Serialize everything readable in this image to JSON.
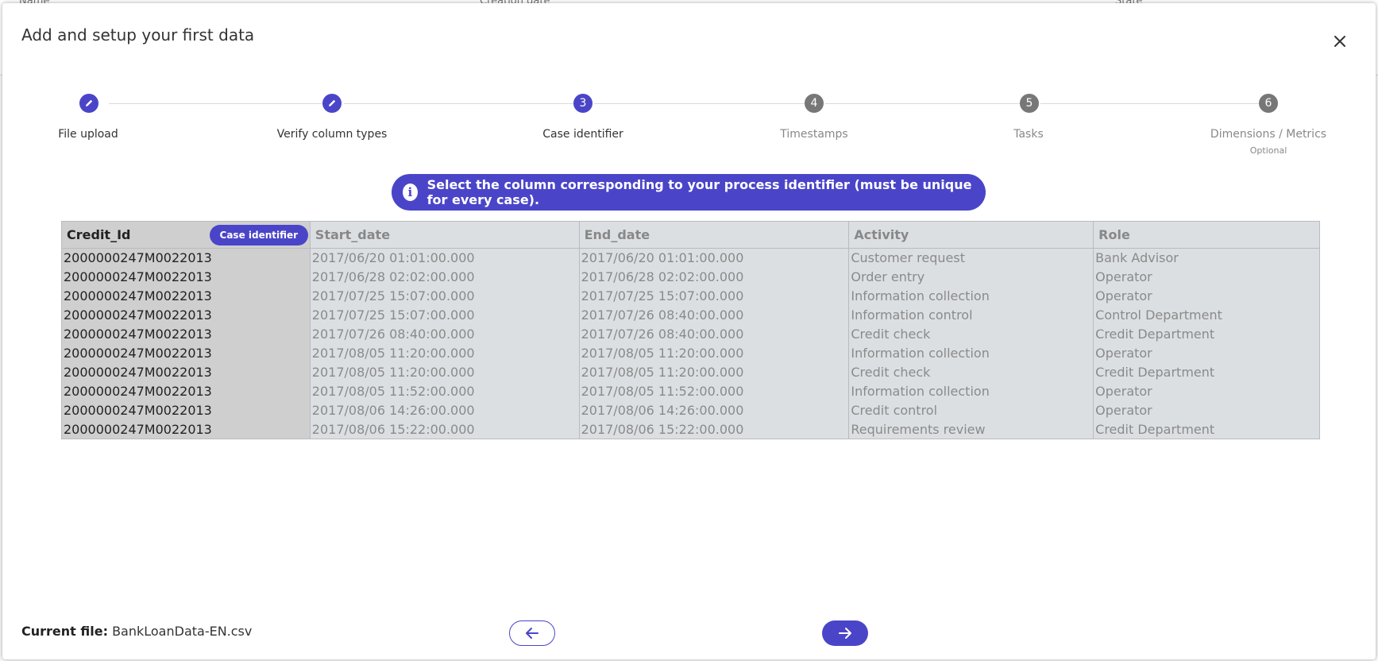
{
  "background": {
    "col_name": "Name",
    "col_creation": "Creation date",
    "col_state": "State"
  },
  "modal": {
    "title": "Add and setup your first data"
  },
  "stepper": {
    "steps": [
      {
        "number": "",
        "label": "File upload",
        "state": "done"
      },
      {
        "number": "",
        "label": "Verify column types",
        "state": "done"
      },
      {
        "number": "3",
        "label": "Case identifier",
        "state": "active"
      },
      {
        "number": "4",
        "label": "Timestamps",
        "state": "todo"
      },
      {
        "number": "5",
        "label": "Tasks",
        "state": "todo"
      },
      {
        "number": "6",
        "label": "Dimensions / Metrics",
        "sublabel": "Optional",
        "state": "todo"
      }
    ]
  },
  "banner": {
    "icon": "i",
    "text": "Select the column corresponding to your process identifier (must be unique for every case)."
  },
  "table": {
    "headers": [
      "Credit_Id",
      "Start_date",
      "End_date",
      "Activity",
      "Role"
    ],
    "badge": "Case identifier",
    "rows": [
      [
        "2000000247M0022013",
        "2017/06/20 01:01:00.000",
        "2017/06/20 01:01:00.000",
        "Customer request",
        "Bank Advisor"
      ],
      [
        "2000000247M0022013",
        "2017/06/28 02:02:00.000",
        "2017/06/28 02:02:00.000",
        "Order entry",
        "Operator"
      ],
      [
        "2000000247M0022013",
        "2017/07/25 15:07:00.000",
        "2017/07/25 15:07:00.000",
        "Information collection",
        "Operator"
      ],
      [
        "2000000247M0022013",
        "2017/07/25 15:07:00.000",
        "2017/07/26 08:40:00.000",
        "Information control",
        "Control Department"
      ],
      [
        "2000000247M0022013",
        "2017/07/26 08:40:00.000",
        "2017/07/26 08:40:00.000",
        "Credit check",
        "Credit Department"
      ],
      [
        "2000000247M0022013",
        "2017/08/05 11:20:00.000",
        "2017/08/05 11:20:00.000",
        "Information collection",
        "Operator"
      ],
      [
        "2000000247M0022013",
        "2017/08/05 11:20:00.000",
        "2017/08/05 11:20:00.000",
        "Credit check",
        "Credit Department"
      ],
      [
        "2000000247M0022013",
        "2017/08/05 11:52:00.000",
        "2017/08/05 11:52:00.000",
        "Information collection",
        "Operator"
      ],
      [
        "2000000247M0022013",
        "2017/08/06 14:26:00.000",
        "2017/08/06 14:26:00.000",
        "Credit control",
        "Operator"
      ],
      [
        "2000000247M0022013",
        "2017/08/06 15:22:00.000",
        "2017/08/06 15:22:00.000",
        "Requirements review",
        "Credit Department"
      ]
    ]
  },
  "footer": {
    "current_file_label": "Current file:",
    "current_file_name": "BankLoanData-EN.csv"
  },
  "colors": {
    "accent": "#4a45c8",
    "todo_step": "#777777"
  }
}
